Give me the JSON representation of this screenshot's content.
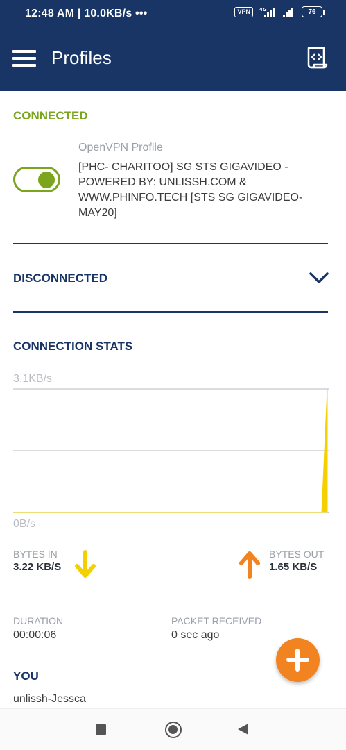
{
  "status_bar": {
    "time": "12:48 AM | 10.0KB/s •••",
    "vpn_badge": "VPN",
    "network_label": "4G",
    "battery": "76"
  },
  "app_bar": {
    "title": "Profiles",
    "menu_icon": "hamburger-menu-icon",
    "import_icon": "import-profile-icon"
  },
  "connected_section": {
    "heading": "CONNECTED",
    "profile_type": "OpenVPN Profile",
    "profile_name": "[PHC- CHARITOO] SG STS GIGAVIDEO - POWERED BY: UNLISSH.COM & WWW.PHINFO.TECH [STS SG GIGAVIDEO-MAY20]",
    "toggle_on": true
  },
  "disconnected_section": {
    "heading": "DISCONNECTED",
    "icon": "chevron-down-icon"
  },
  "stats": {
    "heading": "CONNECTION STATS",
    "y_max_label": "3.1KB/s",
    "y_min_label": "0B/s",
    "bytes_in_label": "BYTES IN",
    "bytes_in_value": "3.22 KB/S",
    "bytes_out_label": "BYTES OUT",
    "bytes_out_value": "1.65 KB/S",
    "duration_label": "DURATION",
    "duration_value": "00:00:06",
    "packet_label": "PACKET RECEIVED",
    "packet_value": "0 sec ago"
  },
  "you_section": {
    "heading": "YOU",
    "username": "unlissh-Jessca"
  },
  "colors": {
    "primary": "#183566",
    "connected": "#7aa51c",
    "bytes_in": "#f5d000",
    "bytes_out": "#f28321",
    "fab": "#f28321"
  },
  "chart_data": {
    "type": "area",
    "ylim": [
      0,
      3.1
    ],
    "y_unit": "KB/s",
    "series": [
      {
        "values": [
          0,
          0,
          0,
          0,
          0,
          0,
          0,
          0,
          0,
          0,
          0,
          0,
          0,
          0,
          0,
          0,
          0,
          0,
          0,
          0,
          3.1
        ]
      }
    ],
    "grid": true
  }
}
